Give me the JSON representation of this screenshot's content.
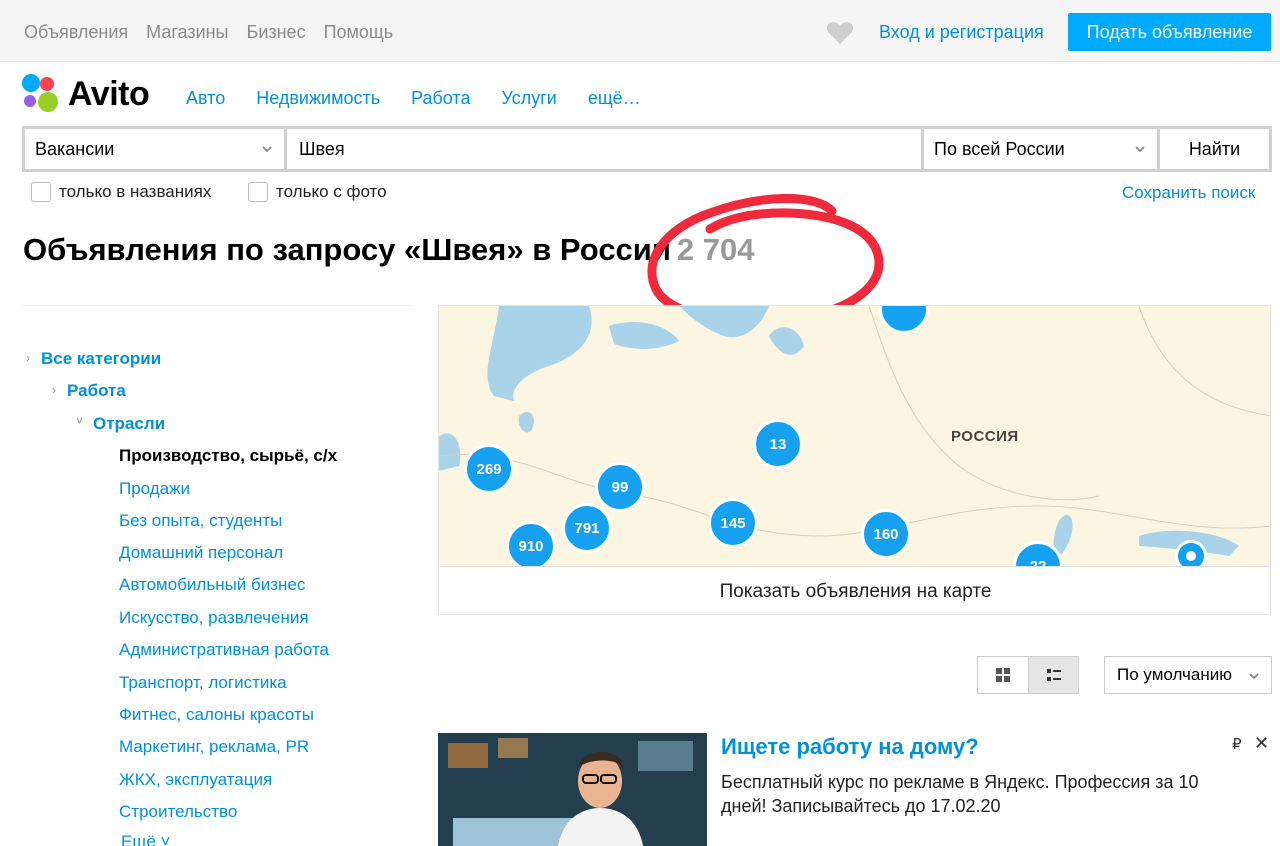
{
  "topbar": {
    "nav": [
      "Объявления",
      "Магазины",
      "Бизнес",
      "Помощь"
    ],
    "login": "Вход и регистрация",
    "post_button": "Подать объявление"
  },
  "logo": {
    "text": "Avito"
  },
  "catnav": [
    "Авто",
    "Недвижимость",
    "Работа",
    "Услуги",
    "ещё…"
  ],
  "search": {
    "category": "Вакансии",
    "query": "Швея",
    "region": "По всей России",
    "button": "Найти"
  },
  "filters": {
    "titles_only": "только в названиях",
    "with_photo": "только с фото",
    "save_search": "Сохранить поиск"
  },
  "heading": {
    "title": "Объявления по запросу «Швея» в России",
    "count": "2 704"
  },
  "sidebar": {
    "all": "Все категории",
    "work": "Работа",
    "industries": "Отрасли",
    "current": "Производство, сырьё, с/х",
    "items": [
      "Продажи",
      "Без опыта, студенты",
      "Домашний персонал",
      "Автомобильный бизнес",
      "Искусство, развлечения",
      "Административная работа",
      "Транспорт, логистика",
      "Фитнес, салоны красоты",
      "Маркетинг, реклама, PR",
      "ЖКХ, эксплуатация",
      "Строительство"
    ],
    "more": "Ещё"
  },
  "map": {
    "country_label": "РОССИЯ",
    "clusters": [
      "269",
      "99",
      "13",
      "791",
      "910",
      "145",
      "160",
      "22"
    ],
    "button": "Показать объявления на карте"
  },
  "sort": {
    "selected": "По умолчанию"
  },
  "ad": {
    "title": "Ищете работу на дому?",
    "text": "Бесплатный курс по рекламе в Яндекс. Профессия за 10 дней! Записывайтесь до 17.02.20",
    "currency_icon": "₽",
    "close_icon": "✕"
  },
  "colors": {
    "link": "#0091d9",
    "accent": "#00aaff",
    "cluster": "#16a0f0",
    "annotation": "#ee2a3c"
  }
}
